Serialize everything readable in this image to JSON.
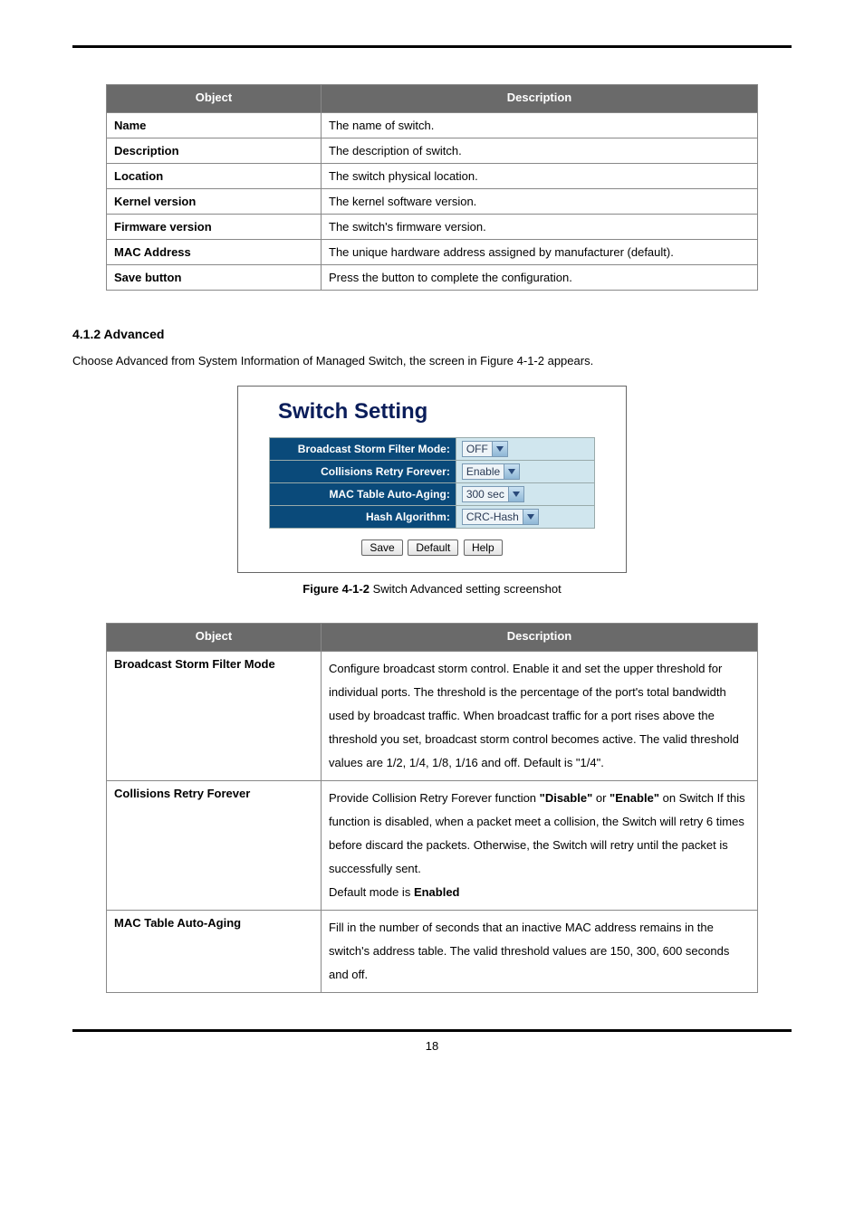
{
  "table1": {
    "headers": [
      "Object",
      "Description"
    ],
    "rows": [
      {
        "object": "Name",
        "desc": "The name of switch."
      },
      {
        "object": "Description",
        "desc": "The description of switch."
      },
      {
        "object": "Location",
        "desc": "The switch physical location."
      },
      {
        "object": "Kernel version",
        "desc": "The kernel software version."
      },
      {
        "object": "Firmware version",
        "desc": "The switch's firmware version."
      },
      {
        "object": "MAC Address",
        "desc": "The unique hardware address assigned by manufacturer (default)."
      },
      {
        "object": "Save button",
        "desc": "Press the button to complete the configuration."
      }
    ]
  },
  "section_heading": "4.1.2 Advanced",
  "intro_para": "Choose Advanced from System Information of Managed Switch, the screen in Figure 4-1-2 appears.",
  "screenshot": {
    "title": "Switch Setting",
    "rows": [
      {
        "label": "Broadcast Storm Filter Mode:",
        "value": "OFF"
      },
      {
        "label": "Collisions Retry Forever:",
        "value": "Enable"
      },
      {
        "label": "MAC Table Auto-Aging:",
        "value": "300 sec"
      },
      {
        "label": "Hash Algorithm:",
        "value": "CRC-Hash"
      }
    ],
    "buttons": [
      "Save",
      "Default",
      "Help"
    ]
  },
  "caption_prefix": "Figure 4-1-2",
  "caption_text": " Switch Advanced setting screenshot",
  "table2": {
    "headers": [
      "Object",
      "Description"
    ],
    "rows": [
      {
        "object": "Broadcast Storm Filter Mode",
        "desc_html": "Configure broadcast storm control. Enable it and set the upper threshold for individual ports. The threshold is the percentage of the port's total bandwidth used by broadcast traffic. When broadcast traffic for a port rises above the threshold you set, broadcast storm control becomes active. The valid threshold values are 1/2, 1/4, 1/8, 1/16 and off. Default is \"1/4\"."
      },
      {
        "object": "Collisions Retry Forever",
        "desc_segments": {
          "s1": "Provide Collision Retry Forever function ",
          "disable": "\"Disable\"",
          "s2": " or ",
          "enable": "\"Enable\"",
          "s3": " on Switch  If this function is disabled, when a packet meet a collision, the Switch will retry 6 times before discard the packets. Otherwise, the Switch will retry until the packet is successfully sent.",
          "s4": "Default mode is ",
          "enabled": "Enabled"
        }
      },
      {
        "object": "MAC Table Auto-Aging",
        "desc_html": "Fill in the number of seconds that an inactive MAC address remains in the switch's address table. The valid threshold values are 150, 300, 600 seconds and off."
      }
    ]
  },
  "page_number": "18"
}
